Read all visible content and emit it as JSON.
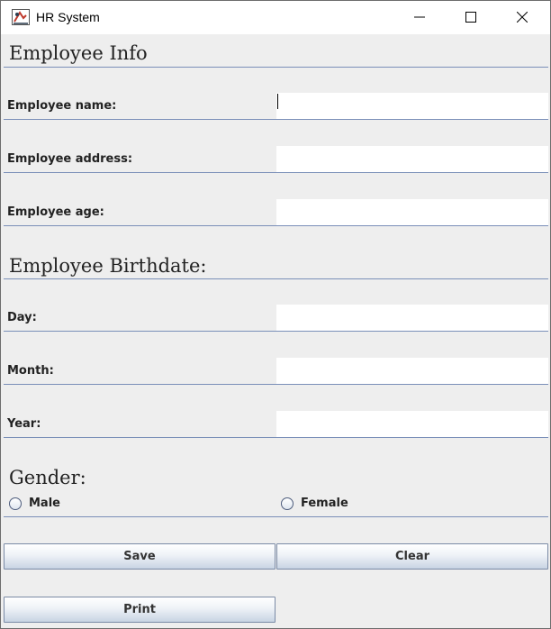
{
  "window": {
    "title": "HR System"
  },
  "sections": {
    "employee_info": "Employee Info",
    "birthdate": "Employee Birthdate:",
    "gender": "Gender:"
  },
  "fields": {
    "name": {
      "label": "Employee name:",
      "value": ""
    },
    "address": {
      "label": "Employee address:",
      "value": ""
    },
    "age": {
      "label": "Employee age:",
      "value": ""
    },
    "day": {
      "label": "Day:",
      "value": ""
    },
    "month": {
      "label": "Month:",
      "value": ""
    },
    "year": {
      "label": "Year:",
      "value": ""
    }
  },
  "gender": {
    "male": {
      "label": "Male",
      "selected": false
    },
    "female": {
      "label": "Female",
      "selected": false
    }
  },
  "buttons": {
    "save": "Save",
    "clear": "Clear",
    "print": "Print"
  },
  "icons": {
    "app": "java-app-icon",
    "minimize": "minimize-icon",
    "maximize": "maximize-icon",
    "close": "close-icon"
  },
  "colors": {
    "panel_background": "#eeeeee",
    "separator": "#7a8fb8",
    "field_background": "#ffffff"
  }
}
